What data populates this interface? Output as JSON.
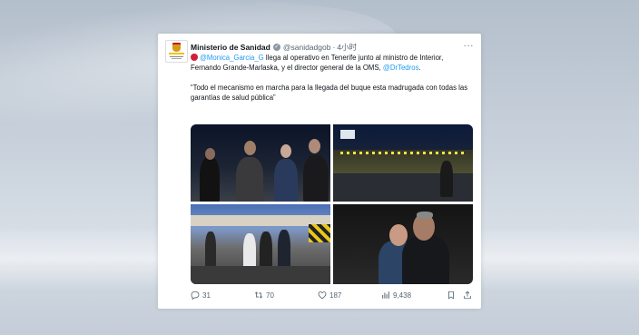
{
  "tweet": {
    "account_name": "Ministerio de Sanidad",
    "handle": "@sanidadgob",
    "separator": "·",
    "time": "4小时",
    "more_icon": "more-dots-icon",
    "text": {
      "mention1": "@Monica_Garcia_G",
      "part1": " llega al operativo en Tenerife junto al ministro de Interior, Fernando Grande-Marlaska, y el director general de la OMS,",
      "mention2": "@DrTedros",
      "part2": ".",
      "quote": "“Todo el mecanismo en marcha para la llegada del buque esta madrugada con todas las garantías de salud pública”"
    },
    "photos": [
      "photo-officials-night",
      "photo-operation-site",
      "photo-walking-group",
      "photo-closeup-officials"
    ],
    "metrics": {
      "replies": "31",
      "reposts": "70",
      "likes": "187",
      "views": "9,438"
    }
  },
  "colors": {
    "link": "#1d9bf0",
    "text": "#0f1419",
    "muted": "#536471",
    "emoji_red": "#d11f3a"
  }
}
